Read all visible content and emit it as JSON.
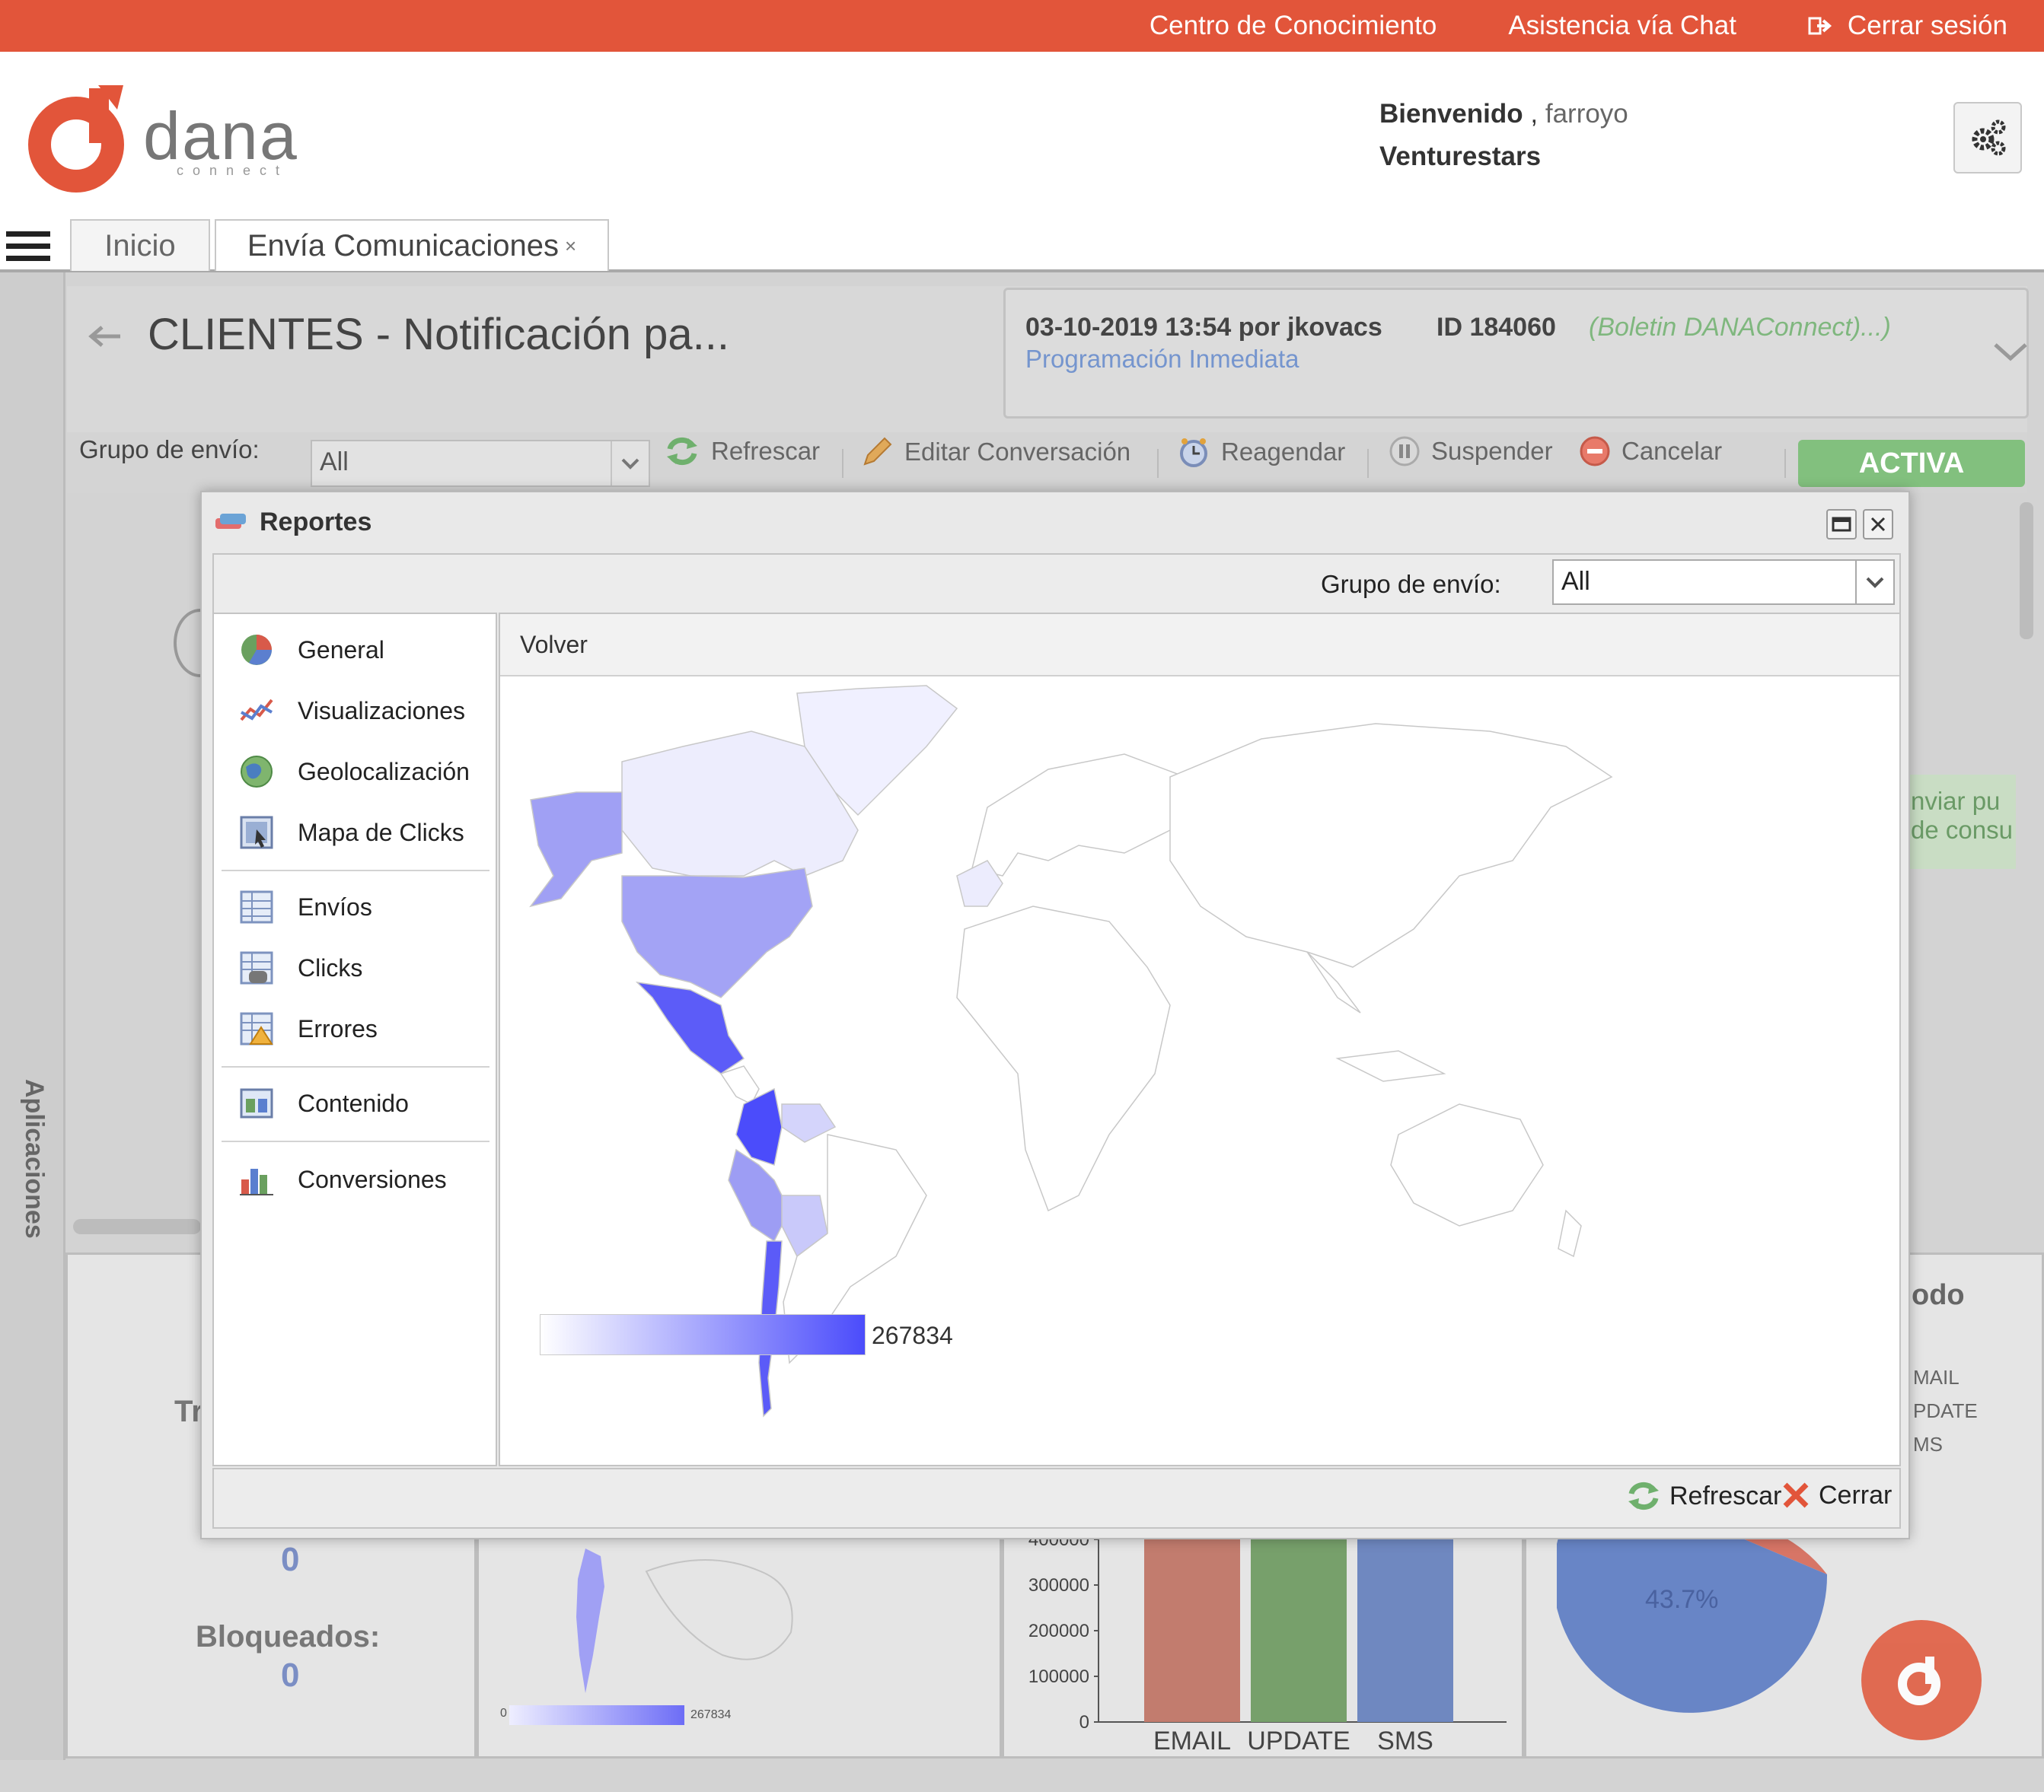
{
  "topbar": {
    "knowledge": "Centro de Conocimiento",
    "chat": "Asistencia vía Chat",
    "logout": "Cerrar sesión"
  },
  "header": {
    "logo_text": "dana",
    "logo_sub": "connect",
    "welcome": "Bienvenido",
    "comma": ",",
    "username": "farroyo",
    "company": "Venturestars"
  },
  "tabs": [
    {
      "label": "Inicio"
    },
    {
      "label": "Envía Comunicaciones",
      "close": "×"
    }
  ],
  "sidebar": {
    "label": "Aplicaciones"
  },
  "campaign": {
    "title": "CLIENTES - Notificación pa...",
    "meta": "03-10-2019 13:54 por jkovacs",
    "id": "ID 184060",
    "template": "(Boletin DANAConnect)...)",
    "schedule": "Programación Inmediata"
  },
  "toolbar": {
    "group_label": "Grupo de envío:",
    "group_value": "All",
    "refresh": "Refrescar",
    "edit": "Editar Conversación",
    "reschedule": "Reagendar",
    "suspend": "Suspender",
    "cancel": "Cancelar",
    "status": "ACTIVA"
  },
  "background": {
    "right_text_1": "nviar pu",
    "right_text_2": "de consu",
    "period_title": "odo",
    "legend": [
      "MAIL",
      "PDATE",
      "MS"
    ],
    "left_letter": "Tr",
    "zero_1": "0",
    "blocked_label": "Bloqueados:",
    "zero_2": "0",
    "mini_scale_min": "0",
    "mini_scale_max": "267834",
    "bar_ticks": [
      "400000",
      "300000",
      "200000",
      "100000",
      "0"
    ],
    "bar_categories": [
      "EMAIL",
      "UPDATE",
      "SMS"
    ],
    "pie_label": "43.7%",
    "colors": {
      "email": "#c27c6e",
      "update": "#77a06b",
      "sms": "#6f88c0",
      "pie_blue": "#6885c6",
      "pie_red": "#d77566"
    }
  },
  "modal": {
    "title": "Reportes",
    "group_label": "Grupo de envío:",
    "group_value": "All",
    "menu": [
      {
        "label": "General",
        "icon": "pie-chart-icon"
      },
      {
        "label": "Visualizaciones",
        "icon": "line-chart-icon"
      },
      {
        "label": "Geolocalización",
        "icon": "globe-icon"
      },
      {
        "label": "Mapa de Clicks",
        "icon": "click-map-icon"
      },
      {
        "label": "Envíos",
        "icon": "table-icon"
      },
      {
        "label": "Clicks",
        "icon": "table-mouse-icon"
      },
      {
        "label": "Errores",
        "icon": "table-warning-icon"
      },
      {
        "label": "Contenido",
        "icon": "content-icon"
      },
      {
        "label": "Conversiones",
        "icon": "bar-chart-icon"
      }
    ],
    "back": "Volver",
    "scale_max": "267834",
    "refresh": "Refrescar",
    "close": "Cerrar",
    "colors": {
      "scale_high": "#4b4cfb",
      "scale_low": "#ffffff"
    }
  }
}
